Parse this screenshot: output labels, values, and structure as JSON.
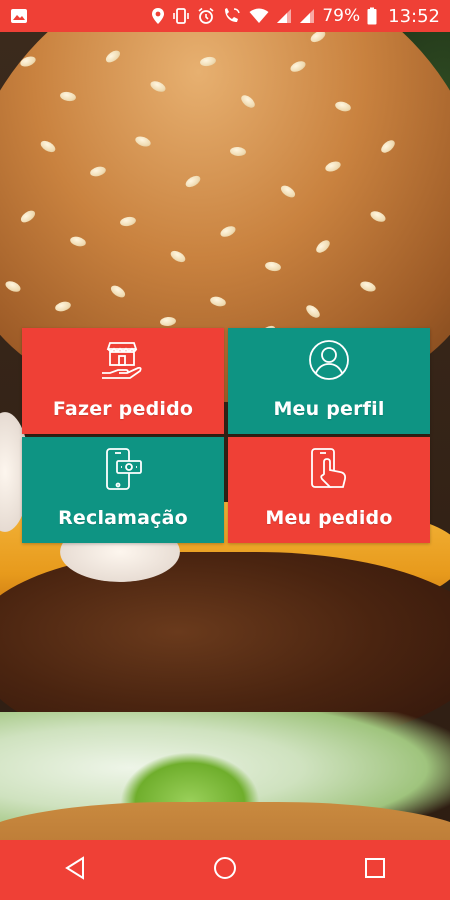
{
  "status_bar": {
    "battery_percent": "79%",
    "time": "13:52",
    "icons": [
      "image-notification-icon",
      "location-icon",
      "vibrate-icon",
      "alarm-icon",
      "wifi-calling-icon",
      "wifi-icon",
      "signal-icon",
      "signal-icon",
      "battery-icon"
    ]
  },
  "menu": {
    "items": [
      {
        "label": "Fazer pedido",
        "icon": "shop-hand-icon",
        "color": "#ef4036"
      },
      {
        "label": "Meu perfil",
        "icon": "user-circle-icon",
        "color": "#0e9483"
      },
      {
        "label": "Reclamação",
        "icon": "phone-dollar-icon",
        "color": "#0e9483"
      },
      {
        "label": "Meu pedido",
        "icon": "phone-tap-icon",
        "color": "#ef4036"
      }
    ]
  },
  "nav_bar": {
    "buttons": [
      "back-icon",
      "home-icon",
      "recents-icon"
    ]
  },
  "colors": {
    "accent_red": "#ef4036",
    "accent_teal": "#0e9483"
  }
}
